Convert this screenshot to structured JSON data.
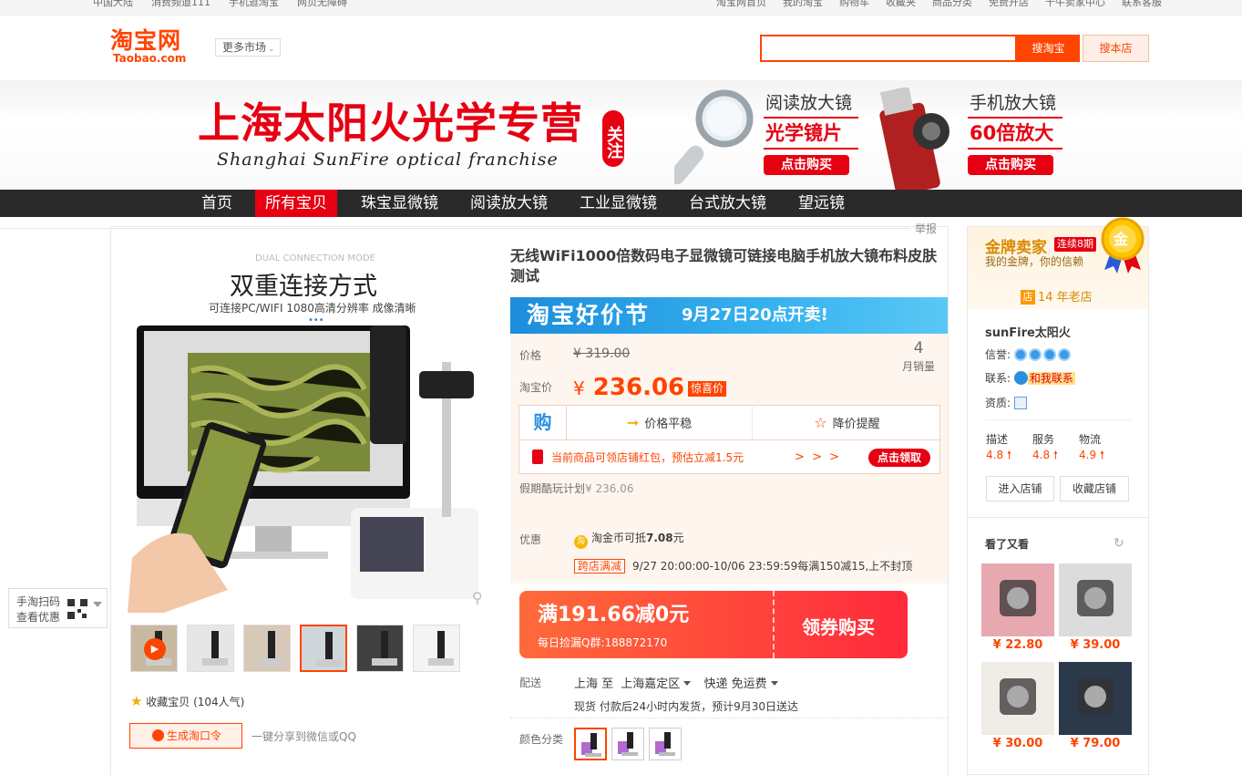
{
  "topbar": {
    "left": [
      "中国大陆",
      "消费频道111",
      "手机逛淘宝",
      "网页无障碍"
    ],
    "right": [
      "淘宝网首页",
      "我的淘宝",
      "购物车",
      "收藏夹",
      "商品分类",
      "免费开店",
      "千牛卖家中心",
      "联系客服"
    ]
  },
  "header": {
    "logo_cn": "淘宝网",
    "logo_en": "Taobao.com",
    "more_market": "更多市场",
    "search_placeholder": "",
    "search_taobao": "搜淘宝",
    "search_shop": "搜本店"
  },
  "banner": {
    "title": "上海太阳火光学专营",
    "subtitle": "Shanghai SunFire optical franchise",
    "follow": "关注",
    "card1": {
      "line1": "阅读放大镜",
      "line2": "光学镜片",
      "button": "点击购买"
    },
    "card2": {
      "line1": "手机放大镜",
      "line2": "60倍放大",
      "button": "点击购买"
    }
  },
  "nav": [
    "首页",
    "所有宝贝",
    "珠宝显微镜",
    "阅读放大镜",
    "工业显微镜",
    "台式放大镜",
    "望远镜"
  ],
  "nav_active": "所有宝贝",
  "report": "举报",
  "gallery": {
    "mode_en": "DUAL CONNECTION MODE",
    "title": "双重连接方式",
    "subtitle": "可连接PC/WIFI 1080高清分辨率 成像清晰"
  },
  "favorite": "收藏宝贝 (104人气)",
  "share_btn": "生成淘口令",
  "share_text": "一键分享到微信或QQ",
  "qr_text": [
    "手淘扫码",
    "查看优惠"
  ],
  "product": {
    "title": "无线WiFi1000倍数码电子显微镜可链接电脑手机放大镜布料皮肤测试",
    "promo_a": "淘宝好价节",
    "promo_b": "9月27日20点开卖!",
    "price_label": "价格",
    "old_price": "¥ 319.00",
    "tb_price_label": "淘宝价",
    "currency": "¥",
    "new_price": "236.06",
    "surprise": "惊喜价",
    "sales_count": "4",
    "sales_unit": "月销量",
    "gou": "购",
    "price_stable": "价格平稳",
    "price_alert": "降价提醒",
    "redpacket": "当前商品可领店铺红包，预估立减1.5元",
    "arrows": "> > >",
    "get_btn": "点击领取",
    "holiday_label": "假期酷玩计划",
    "holiday_value": "¥ 236.06",
    "youhui": "优惠",
    "coin_text": "淘金币可抵",
    "coin_value": "7.08",
    "coin_unit": "元",
    "cross_tag": "跨店满减",
    "cross_text": "9/27 20:00:00-10/06 23:59:59每满150减15,上不封顶",
    "coupon_main": "满191.66减0元",
    "coupon_qq": "每日捡漏Q群:188872170",
    "coupon_btn": "领券购买",
    "ship_label": "配送",
    "ship_from": "上海 至",
    "ship_to": "上海嘉定区",
    "ship_mode": "快递 免运费",
    "ship_note": "现货 付款后24小时内发货，预计9月30日送达",
    "color_label": "颜色分类"
  },
  "shop": {
    "gold_title": "金牌卖家",
    "gold_tag": "连续8期",
    "gold_sub": "我的金牌，你的信赖",
    "medal": "金",
    "years_icon": "店",
    "years": "14 年老店",
    "name": "sunFire太阳火",
    "credit_label": "信誉:",
    "contact_label": "联系:",
    "contact_btn": "和我联系",
    "qual_label": "资质:",
    "scores": [
      {
        "label": "描述",
        "value": "4.8"
      },
      {
        "label": "服务",
        "value": "4.8"
      },
      {
        "label": "物流",
        "value": "4.9"
      }
    ],
    "enter_shop": "进入店铺",
    "fav_shop": "收藏店铺"
  },
  "seen": {
    "title": "看了又看",
    "items": [
      {
        "price": "¥ 22.80"
      },
      {
        "price": "¥ 39.00"
      },
      {
        "price": "¥ 30.00"
      },
      {
        "price": "¥ 79.00"
      }
    ]
  }
}
